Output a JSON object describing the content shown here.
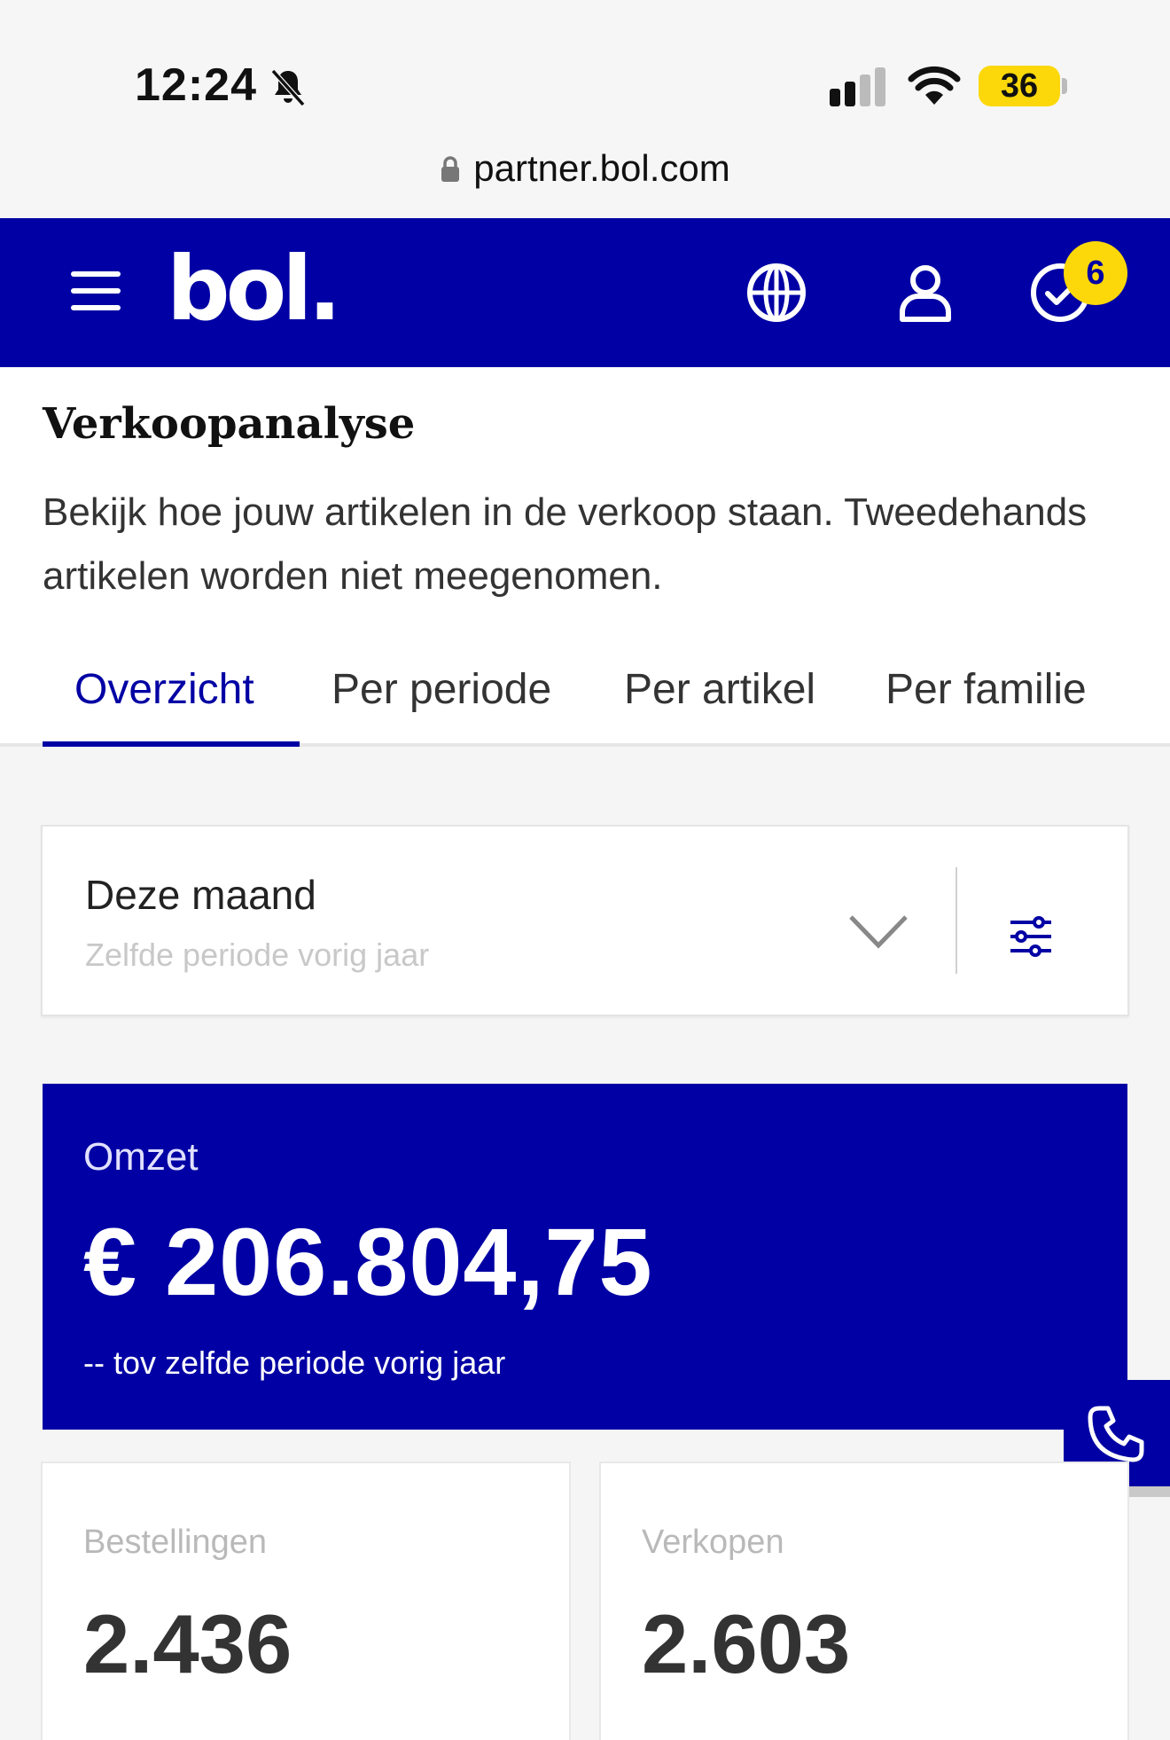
{
  "statusbar": {
    "time": "12:24",
    "battery": "36",
    "url": "partner.bol.com"
  },
  "header": {
    "logo": "bol.",
    "notification_count": "6"
  },
  "intro": {
    "title": "Verkoopanalyse",
    "description": "Bekijk hoe jouw artikelen in de verkoop staan. Tweedehands artikelen worden niet meegenomen."
  },
  "tabs": [
    {
      "label": "Overzicht",
      "active": true
    },
    {
      "label": "Per periode",
      "active": false
    },
    {
      "label": "Per artikel",
      "active": false
    },
    {
      "label": "Per familie",
      "active": false
    }
  ],
  "filter": {
    "period": "Deze maand",
    "comparison": "Zelfde periode vorig jaar"
  },
  "omzet": {
    "label": "Omzet",
    "value": "€ 206.804,75",
    "comparison": "-- tov zelfde periode vorig jaar"
  },
  "stats": [
    {
      "label": "Bestellingen",
      "value": "2.436"
    },
    {
      "label": "Verkopen",
      "value": "2.603"
    }
  ],
  "colors": {
    "brand_blue": "#0000a4",
    "badge_yellow": "#fcd80a"
  },
  "icons": {
    "bell": "bell-slash-icon",
    "globe": "globe-icon",
    "user": "user-icon",
    "check": "check-circle-icon",
    "filter": "sliders-icon",
    "phone": "phone-icon"
  }
}
